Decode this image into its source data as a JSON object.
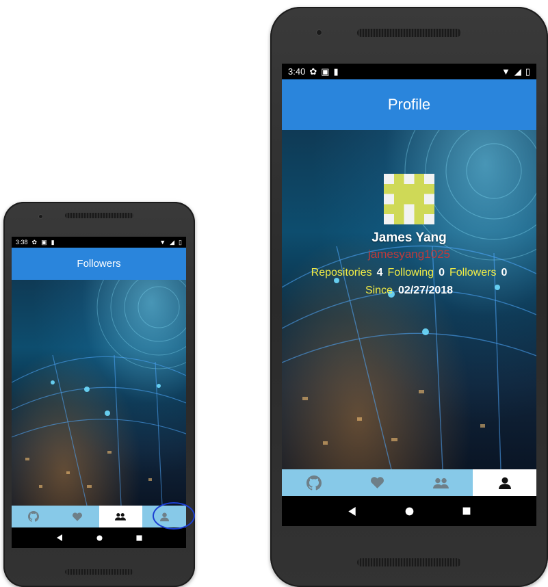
{
  "left_phone": {
    "status": {
      "time": "3:38"
    },
    "app_bar": {
      "title": "Followers"
    },
    "tabs": [
      {
        "icon": "github-icon",
        "active": false
      },
      {
        "icon": "heart-icon",
        "active": false
      },
      {
        "icon": "people-icon",
        "active": true
      },
      {
        "icon": "person-icon",
        "active": false
      }
    ]
  },
  "right_phone": {
    "status": {
      "time": "3:40"
    },
    "app_bar": {
      "title": "Profile"
    },
    "profile": {
      "name": "James Yang",
      "login": "jamesyang1025",
      "repositories_label": "Repositories",
      "repositories_value": "4",
      "following_label": "Following",
      "following_value": "0",
      "followers_label": "Followers",
      "followers_value": "0",
      "since_label": "Since",
      "since_value": "02/27/2018"
    },
    "tabs": [
      {
        "icon": "github-icon",
        "active": false
      },
      {
        "icon": "heart-icon",
        "active": false
      },
      {
        "icon": "people-icon",
        "active": false
      },
      {
        "icon": "person-icon",
        "active": true
      }
    ]
  },
  "colors": {
    "app_bar": "#2a85dc",
    "tab_bar": "#87c9e8",
    "stat_label": "#f4ee45",
    "login": "#c03a3a",
    "annotation": "#1c3fd1"
  }
}
